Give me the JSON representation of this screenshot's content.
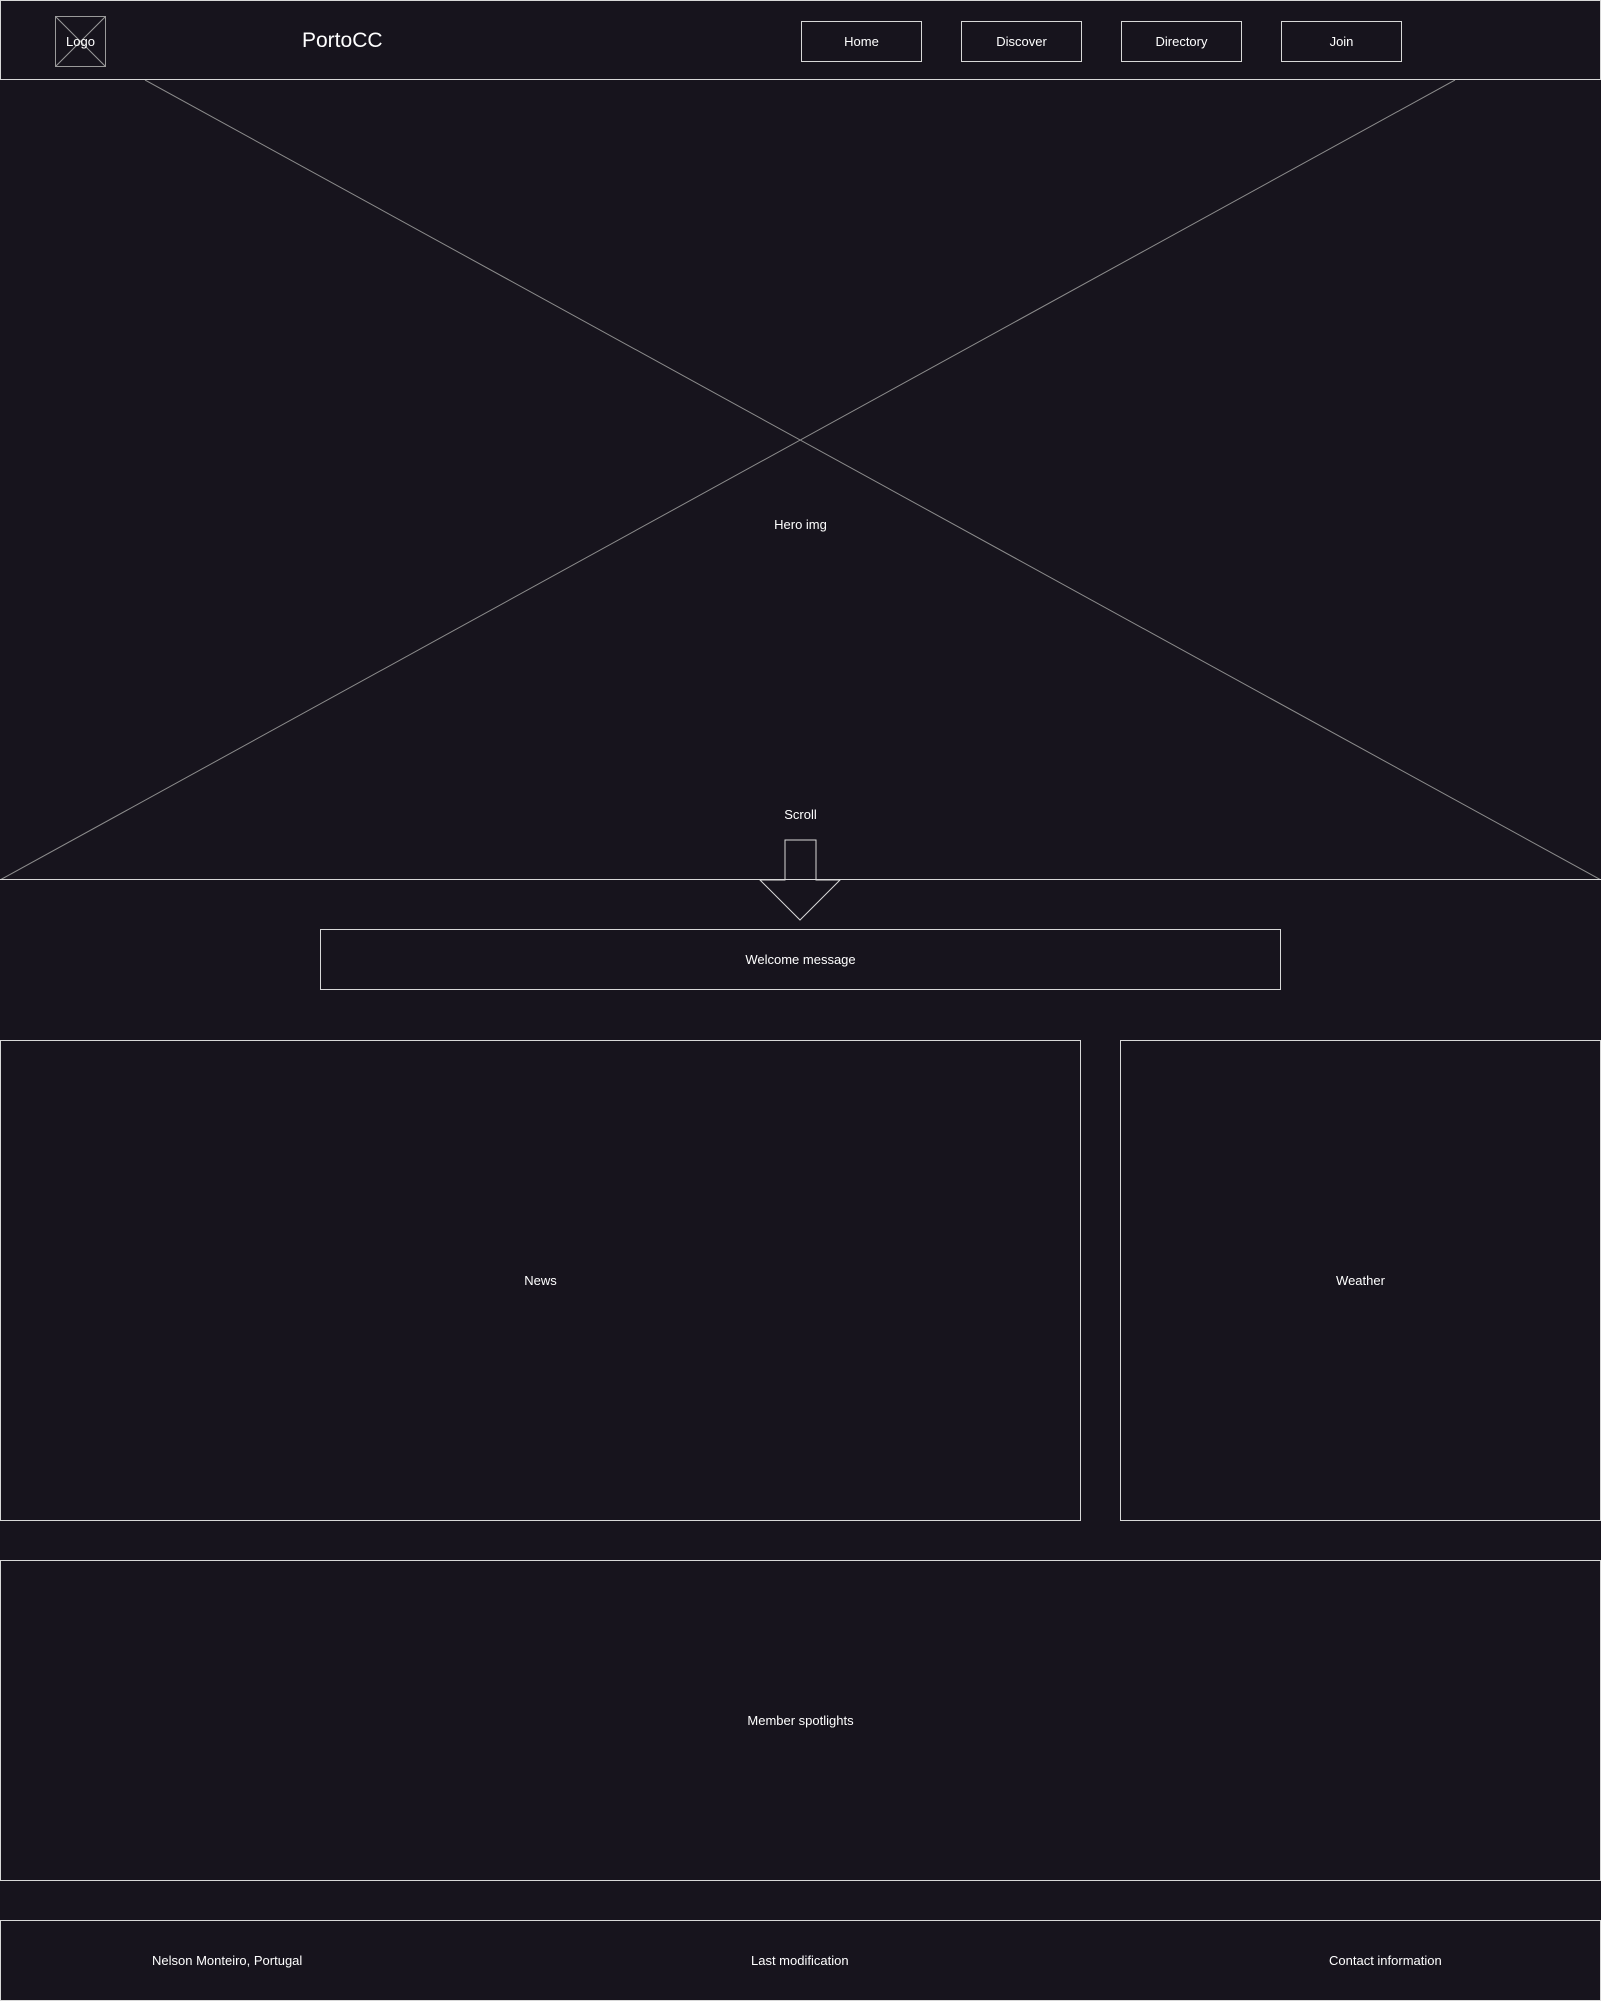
{
  "header": {
    "logo_label": "Logo",
    "site_name": "PortoCC",
    "nav": [
      {
        "label": "Home"
      },
      {
        "label": "Discover"
      },
      {
        "label": "Directory"
      },
      {
        "label": "Join"
      }
    ]
  },
  "hero": {
    "label": "Hero img",
    "scroll_label": "Scroll",
    "scroll_icon": "arrow-down-icon"
  },
  "welcome": {
    "label": "Welcome message"
  },
  "news": {
    "label": "News"
  },
  "weather": {
    "label": "Weather"
  },
  "spotlights": {
    "label": "Member spotlights"
  },
  "footer": {
    "author": "Nelson Monteiro, Portugal",
    "last_modification": "Last modification",
    "contact": "Contact information"
  },
  "colors": {
    "background": "#17141d",
    "border": "#d8d8d8",
    "text": "#ffffff"
  }
}
